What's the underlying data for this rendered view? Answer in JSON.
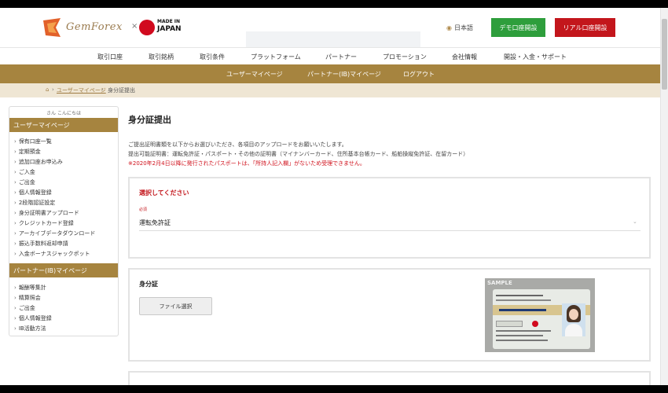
{
  "header": {
    "logo_text": "GemForex",
    "logo_x": "×",
    "made_in": "MADE IN",
    "japan": "JAPAN",
    "lang_label": "日本語",
    "demo_button": "デモ口座開設",
    "real_button": "リアル口座開設"
  },
  "main_nav": [
    "取引口座",
    "取引銘柄",
    "取引条件",
    "プラットフォーム",
    "パートナー",
    "プロモーション",
    "会社情報",
    "開設・入金・サポート"
  ],
  "sub_nav": [
    "ユーザーマイページ",
    "パートナー(IB)マイページ",
    "ログアウト"
  ],
  "breadcrumb": {
    "home_icon": "home-icon",
    "sep1": "›",
    "mypage": "ユーザーマイページ",
    "sep2": "›",
    "current": "身分証提出"
  },
  "sidebar": {
    "greeting": "さん こんにちは",
    "user_heading": "ユーザーマイページ",
    "user_items": [
      "保有口座一覧",
      "定期預金",
      "追加口座お申込み",
      "ご入金",
      "ご出金",
      "個人情報登録",
      "2段階認証設定",
      "身分証明書アップロード",
      "クレジットカード登録",
      "アーカイブデータダウンロード",
      "振込手数料返却申請",
      "入金ボーナスジャックポット"
    ],
    "partner_heading": "パートナー(IB)マイページ",
    "partner_items": [
      "報酬等集計",
      "精算照会",
      "ご出金",
      "個人情報登録",
      "IB活動方法"
    ]
  },
  "main": {
    "title": "身分証提出",
    "intro1": "ご提出証明書類を以下からお選びいただき、各項目のアップロードをお願いいたします。",
    "intro2": "提出可能証明書：運転免許証・パスポート・その他の証明書（マイナンバーカード、住所基本台帳カード、船舶操縦免許証、在留カード）",
    "intro_warning": "※2020年2月4日以降に発行されたパスポートは、「所持人記入欄」がないため受理できません。",
    "select_card": {
      "label": "選択してください",
      "required": "必須",
      "value": "運転免許証",
      "caret": "⌄"
    },
    "id_card": {
      "title": "身分証",
      "file_button": "ファイル選択",
      "sample_label": "SAMPLE"
    }
  },
  "colors": {
    "gold": "#a6843f",
    "demo_green": "#2e9e3c",
    "real_red": "#c3161c",
    "crumb_bg": "#efe6d4",
    "warning_red": "#d0101b"
  }
}
